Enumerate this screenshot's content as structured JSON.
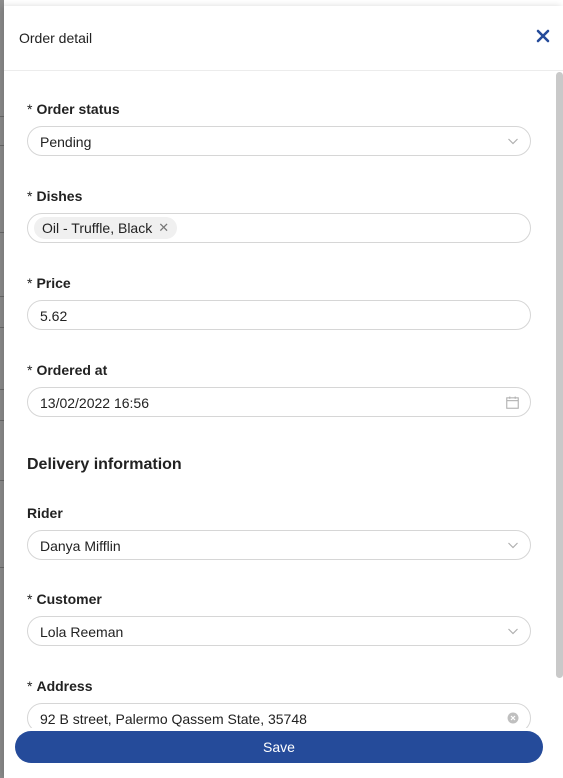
{
  "drawer": {
    "title": "Order detail",
    "close_icon": "close-icon",
    "save_label": "Save"
  },
  "form": {
    "required_mark": "*",
    "order_status": {
      "label": "Order status",
      "value": "Pending",
      "icon": "chevron-down-icon"
    },
    "dishes": {
      "label": "Dishes",
      "tags": [
        "Oil - Truffle, Black"
      ],
      "remove_icon": "close-icon"
    },
    "price": {
      "label": "Price",
      "value": "5.62"
    },
    "ordered_at": {
      "label": "Ordered at",
      "value": "13/02/2022 16:56",
      "icon": "calendar-icon"
    },
    "delivery_heading": "Delivery information",
    "rider": {
      "label": "Rider",
      "value": "Danya Mifflin",
      "icon": "chevron-down-icon"
    },
    "customer": {
      "label": "Customer",
      "value": "Lola Reeman",
      "icon": "chevron-down-icon"
    },
    "address": {
      "label": "Address",
      "value": "92 B street, Palermo Qassem State, 35748",
      "icon": "clear-circle-icon"
    }
  },
  "colors": {
    "primary": "#254b9a",
    "border": "#d6d6d6",
    "text": "#222222"
  }
}
